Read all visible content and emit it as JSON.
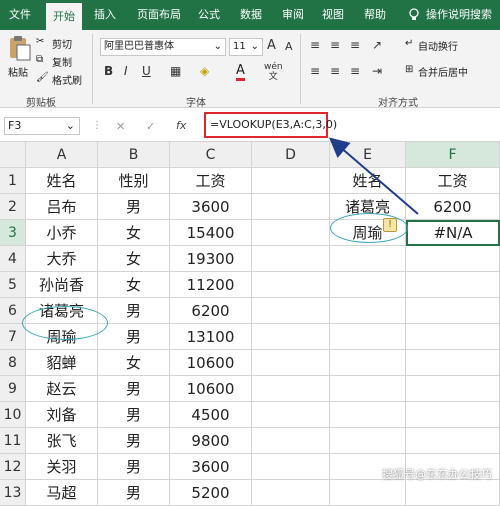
{
  "ribbon": {
    "tabs": [
      "文件",
      "开始",
      "插入",
      "页面布局",
      "公式",
      "数据",
      "审阅",
      "视图",
      "帮助"
    ],
    "active_tab": "开始",
    "help_hint": "操作说明搜索",
    "clipboard": {
      "paste": "粘贴",
      "cut": "剪切",
      "copy": "复制",
      "format_painter": "格式刷",
      "group_label": "剪贴板"
    },
    "font": {
      "name": "阿里巴巴普惠体",
      "size": "11",
      "bold": "B",
      "italic": "I",
      "underline": "U",
      "grow": "A",
      "shrink": "A",
      "wen": "wén",
      "color_a": "A",
      "group_label": "字体"
    },
    "alignment": {
      "wrap": "自动换行",
      "merge": "合并后居中",
      "group_label": "对齐方式"
    }
  },
  "formula_bar": {
    "name_box": "F3",
    "cancel": "✕",
    "enter": "✓",
    "fx": "fx",
    "formula": "=VLOOKUP(E3,A:C,3,0)"
  },
  "columns": [
    "A",
    "B",
    "C",
    "D",
    "E",
    "F"
  ],
  "rows": [
    [
      "1",
      "姓名",
      "性别",
      "工资",
      "",
      "姓名",
      "工资"
    ],
    [
      "2",
      "吕布",
      "男",
      "3600",
      "",
      "诸葛亮",
      "6200"
    ],
    [
      "3",
      "小乔",
      "女",
      "15400",
      "",
      "周瑜",
      "#N/A"
    ],
    [
      "4",
      "大乔",
      "女",
      "19300",
      "",
      "",
      ""
    ],
    [
      "5",
      "孙尚香",
      "女",
      "11200",
      "",
      "",
      ""
    ],
    [
      "6",
      "诸葛亮",
      "男",
      "6200",
      "",
      "",
      ""
    ],
    [
      "7",
      "周瑜",
      "男",
      "13100",
      "",
      "",
      ""
    ],
    [
      "8",
      "貂蝉",
      "女",
      "10600",
      "",
      "",
      ""
    ],
    [
      "9",
      "赵云",
      "男",
      "10600",
      "",
      "",
      ""
    ],
    [
      "10",
      "刘备",
      "男",
      "4500",
      "",
      "",
      ""
    ],
    [
      "11",
      "张飞",
      "男",
      "9800",
      "",
      "",
      ""
    ],
    [
      "12",
      "关羽",
      "男",
      "3600",
      "",
      "",
      ""
    ],
    [
      "13",
      "马超",
      "男",
      "5200",
      "",
      "",
      ""
    ]
  ],
  "watermark": "搜狐号@东东办公技巧",
  "colors": {
    "ribbon_green": "#217346",
    "highlight_red": "#e0262b",
    "arrow_blue": "#1f3d8a",
    "ellipse": "#3aa6b9"
  }
}
